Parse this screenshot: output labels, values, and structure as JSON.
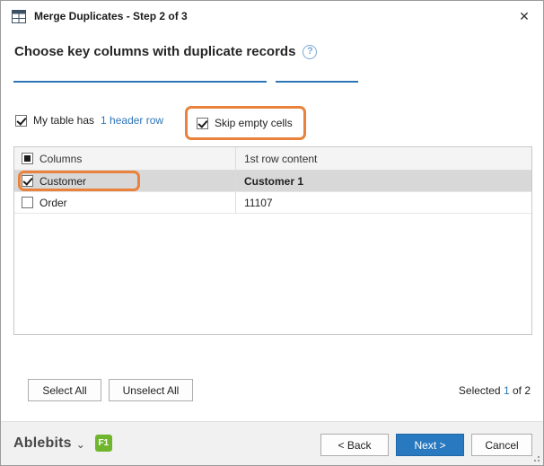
{
  "window": {
    "title": "Merge Duplicates - Step 2 of 3"
  },
  "icons": {
    "close": "✕",
    "help": "?",
    "chevron_down": "⌄"
  },
  "heading": {
    "title": "Choose key columns with duplicate records"
  },
  "options": {
    "table_has_prefix": "My table has",
    "table_has_link": "1 header row",
    "skip_empty_label": "Skip empty cells"
  },
  "table": {
    "header": {
      "col1": "Columns",
      "col2": "1st row content"
    },
    "rows": [
      {
        "name": "Customer",
        "content": "Customer 1",
        "checked": true,
        "selected": true
      },
      {
        "name": "Order",
        "content": "11107",
        "checked": false,
        "selected": false
      }
    ]
  },
  "actions": {
    "select_all": "Select All",
    "unselect_all": "Unselect All"
  },
  "status": {
    "prefix": "Selected",
    "count": "1",
    "suffix": "of 2"
  },
  "footer": {
    "brand": "Ablebits",
    "badge": "F1",
    "back": "< Back",
    "next": "Next >",
    "cancel": "Cancel"
  },
  "colors": {
    "accent": "#2e75b6",
    "annotation_orange": "#e8823c",
    "primary_button": "#2879bf",
    "selected_row": "#d8d8d8",
    "badge_green": "#6fb62c"
  }
}
